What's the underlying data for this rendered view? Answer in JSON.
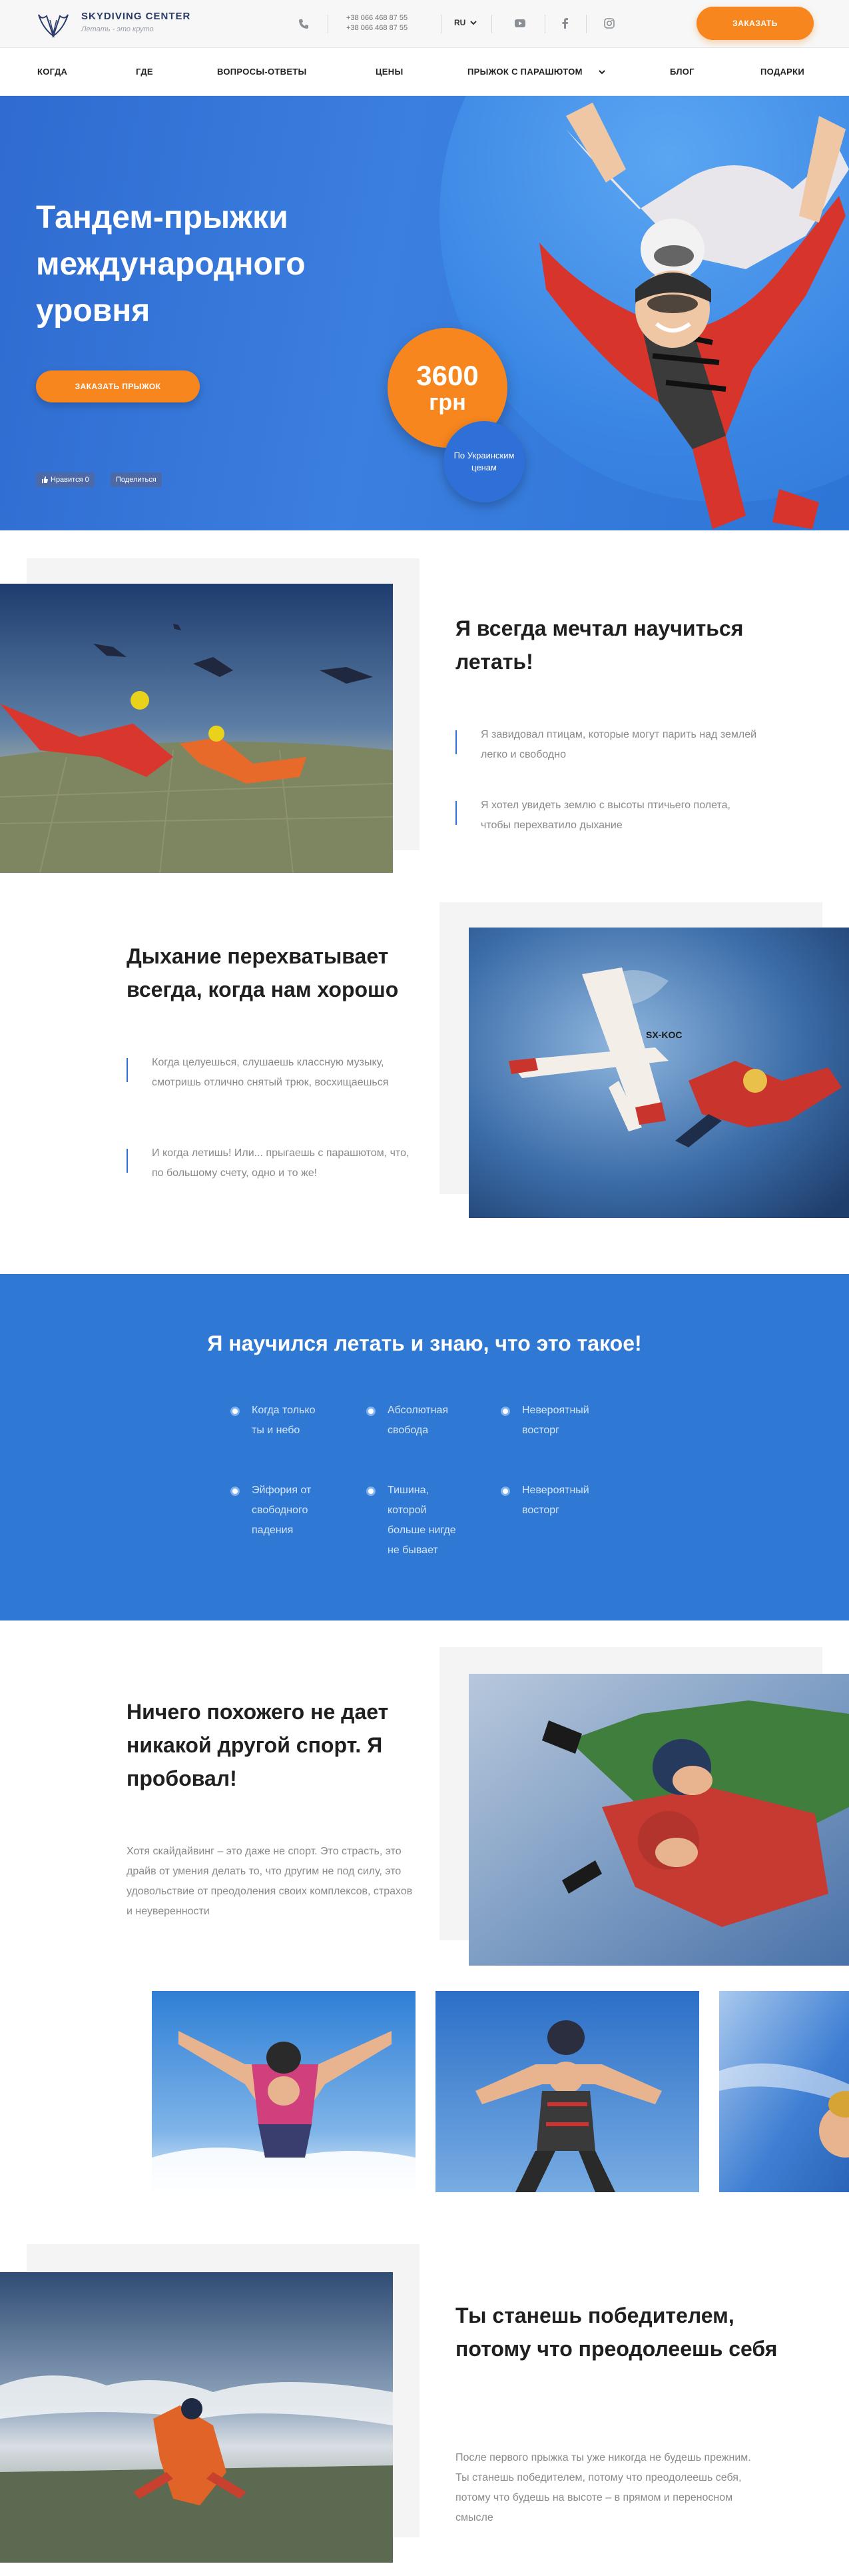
{
  "header": {
    "brand": "SKYDIVING CENTER",
    "tagline": "Летать - это круто",
    "phones": [
      "+38 066 468 87 55",
      "+38 066 468 87 55"
    ],
    "language": "RU",
    "order_label": "ЗАКАЗАТЬ"
  },
  "nav": {
    "items": [
      "КОГДА",
      "ГДЕ",
      "ВОПРОСЫ-ОТВЕТЫ",
      "ЦЕНЫ",
      "ПРЫЖОК С ПАРАШЮТОМ",
      "БЛОГ",
      "ПОДАРКИ"
    ]
  },
  "hero": {
    "title": "Тандем-прыжки международного уровня",
    "cta": "ЗАКАЗАТЬ ПРЫЖОК",
    "like": "Нравится 0",
    "share": "Поделиться",
    "price": "3600",
    "currency": "грн",
    "price_note": "По Украинским ценам"
  },
  "section1": {
    "title": "Я всегда мечтал научиться летать!",
    "quotes": [
      "Я завидовал птицам, которые могут парить над землей легко и свободно",
      "Я хотел увидеть землю с высоты птичьего полета, чтобы перехватило дыхание"
    ]
  },
  "section2": {
    "title": "Дыхание перехватывает всегда, когда нам хорошо",
    "quotes": [
      "Когда целуешься, слушаешь классную музыку, смотришь отлично снятый трюк, восхищаешься",
      "И когда летишь! Или... прыгаешь с парашютом, что, по большому счету, одно и то же!"
    ],
    "plane_reg": "SX-KOC"
  },
  "blue": {
    "title": "Я научился летать и знаю, что это такое!",
    "features": [
      "Когда только ты и небо",
      "Абсолютная свобода",
      "Невероятный восторг",
      "Эйфория от свободного падения",
      "Тишина, которой больше нигде не бывает",
      "Невероятный восторг"
    ]
  },
  "section3": {
    "title": "Ничего похожего не дает никакой другой спорт. Я пробовал!",
    "text": "Хотя скайдайвинг – это даже не спорт. Это страсть, это драйв от умения делать то, что другим не под силу, это удовольствие от преодоления своих комплексов, страхов и неуверенности"
  },
  "section4": {
    "title": "Ты станешь победителем, потому что преодолеешь себя",
    "text": "После первого прыжка ты уже никогда не будешь прежним. Ты станешь победителем, потому что преодолеешь себя, потому что будешь на высоте – в прямом и переносном смысле"
  },
  "colors": {
    "accent_orange": "#f7861e",
    "brand_blue": "#2f79d4",
    "brand_navy": "#2a3c6b"
  }
}
